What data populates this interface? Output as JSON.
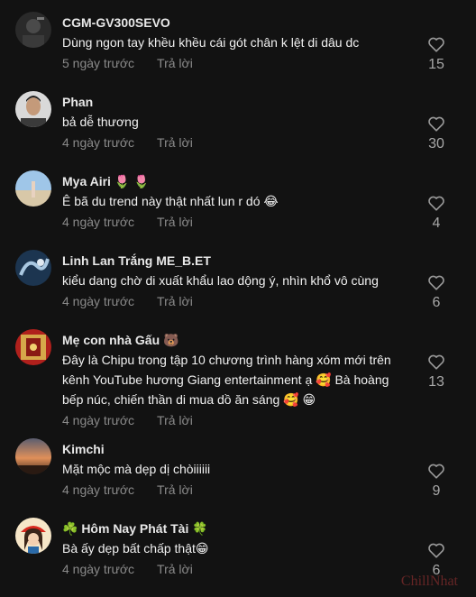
{
  "comments": [
    {
      "username": "CGM-GV300SEVO",
      "text": "Dùng ngon tay khều khều cái gót chân k lệt di dâu dc",
      "time": "5 ngày trước",
      "reply": "Trả lời",
      "likes": "15",
      "avatar": "dark-photo"
    },
    {
      "username": "Phan",
      "text": "bả dễ thương",
      "time": "4 ngày trước",
      "reply": "Trả lời",
      "likes": "30",
      "avatar": "man-portrait"
    },
    {
      "username": "Mya Airi 🌷 🌷",
      "text": "Ê bã du trend này thật nhất lun r dó 😂",
      "time": "4 ngày trước",
      "reply": "Trả lời",
      "likes": "4",
      "avatar": "beach-photo"
    },
    {
      "username": "Linh Lan Trắng ME_B.ET",
      "text": "kiểu dang chờ di xuất khẩu lao dộng ý, nhìn khổ vô cùng",
      "time": "4 ngày trước",
      "reply": "Trả lời",
      "likes": "6",
      "avatar": "dragon-art"
    },
    {
      "username": "Mẹ con nhà Gấu 🐻",
      "text": "Đây là Chipu trong tập 10 chương trình hàng xóm mới trên kênh YouTube hương Giang entertainment ạ 🥰 Bà hoàng bếp núc, chiến thần di mua dồ ăn sáng 🥰 😁",
      "time": "4 ngày trước",
      "reply": "Trả lời",
      "likes": "13",
      "avatar": "red-decor"
    },
    {
      "username": "Kimchi",
      "text": "Mặt mộc mà dẹp dị chòiiiiii",
      "time": "4 ngày trước",
      "reply": "Trả lời",
      "likes": "9",
      "avatar": "sunset-photo"
    },
    {
      "username": "☘️ Hôm Nay Phát Tài 🍀",
      "text": "Bà ấy dẹp bất chấp thật😁",
      "time": "4 ngày trước",
      "reply": "Trả lời",
      "likes": "6",
      "avatar": "cartoon-girl"
    }
  ],
  "watermark": "ChillNhat",
  "colors": {
    "background": "#121212",
    "username": "#e8e8e8",
    "meta": "#8a8a8a",
    "heart": "#9a9a9a"
  }
}
